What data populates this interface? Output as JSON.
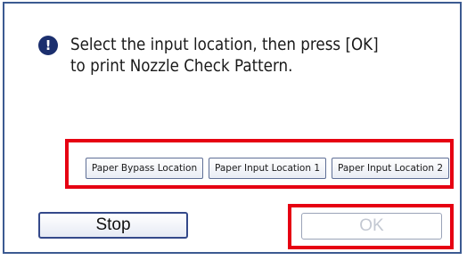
{
  "dialog": {
    "message_lines": [
      "Select the input location, then press [OK]",
      "to print Nozzle Check Pattern."
    ],
    "alert_icon_glyph": "!",
    "alert_icon_name": "alert-icon"
  },
  "locations": {
    "buttons": [
      "Paper Bypass Location",
      "Paper Input Location 1",
      "Paper Input Location 2"
    ]
  },
  "actions": {
    "stop_label": "Stop",
    "ok_label": "OK"
  },
  "colors": {
    "highlight": "#e60012",
    "dialog_border": "#3c5a91",
    "icon_bg": "#1b2f6e"
  }
}
